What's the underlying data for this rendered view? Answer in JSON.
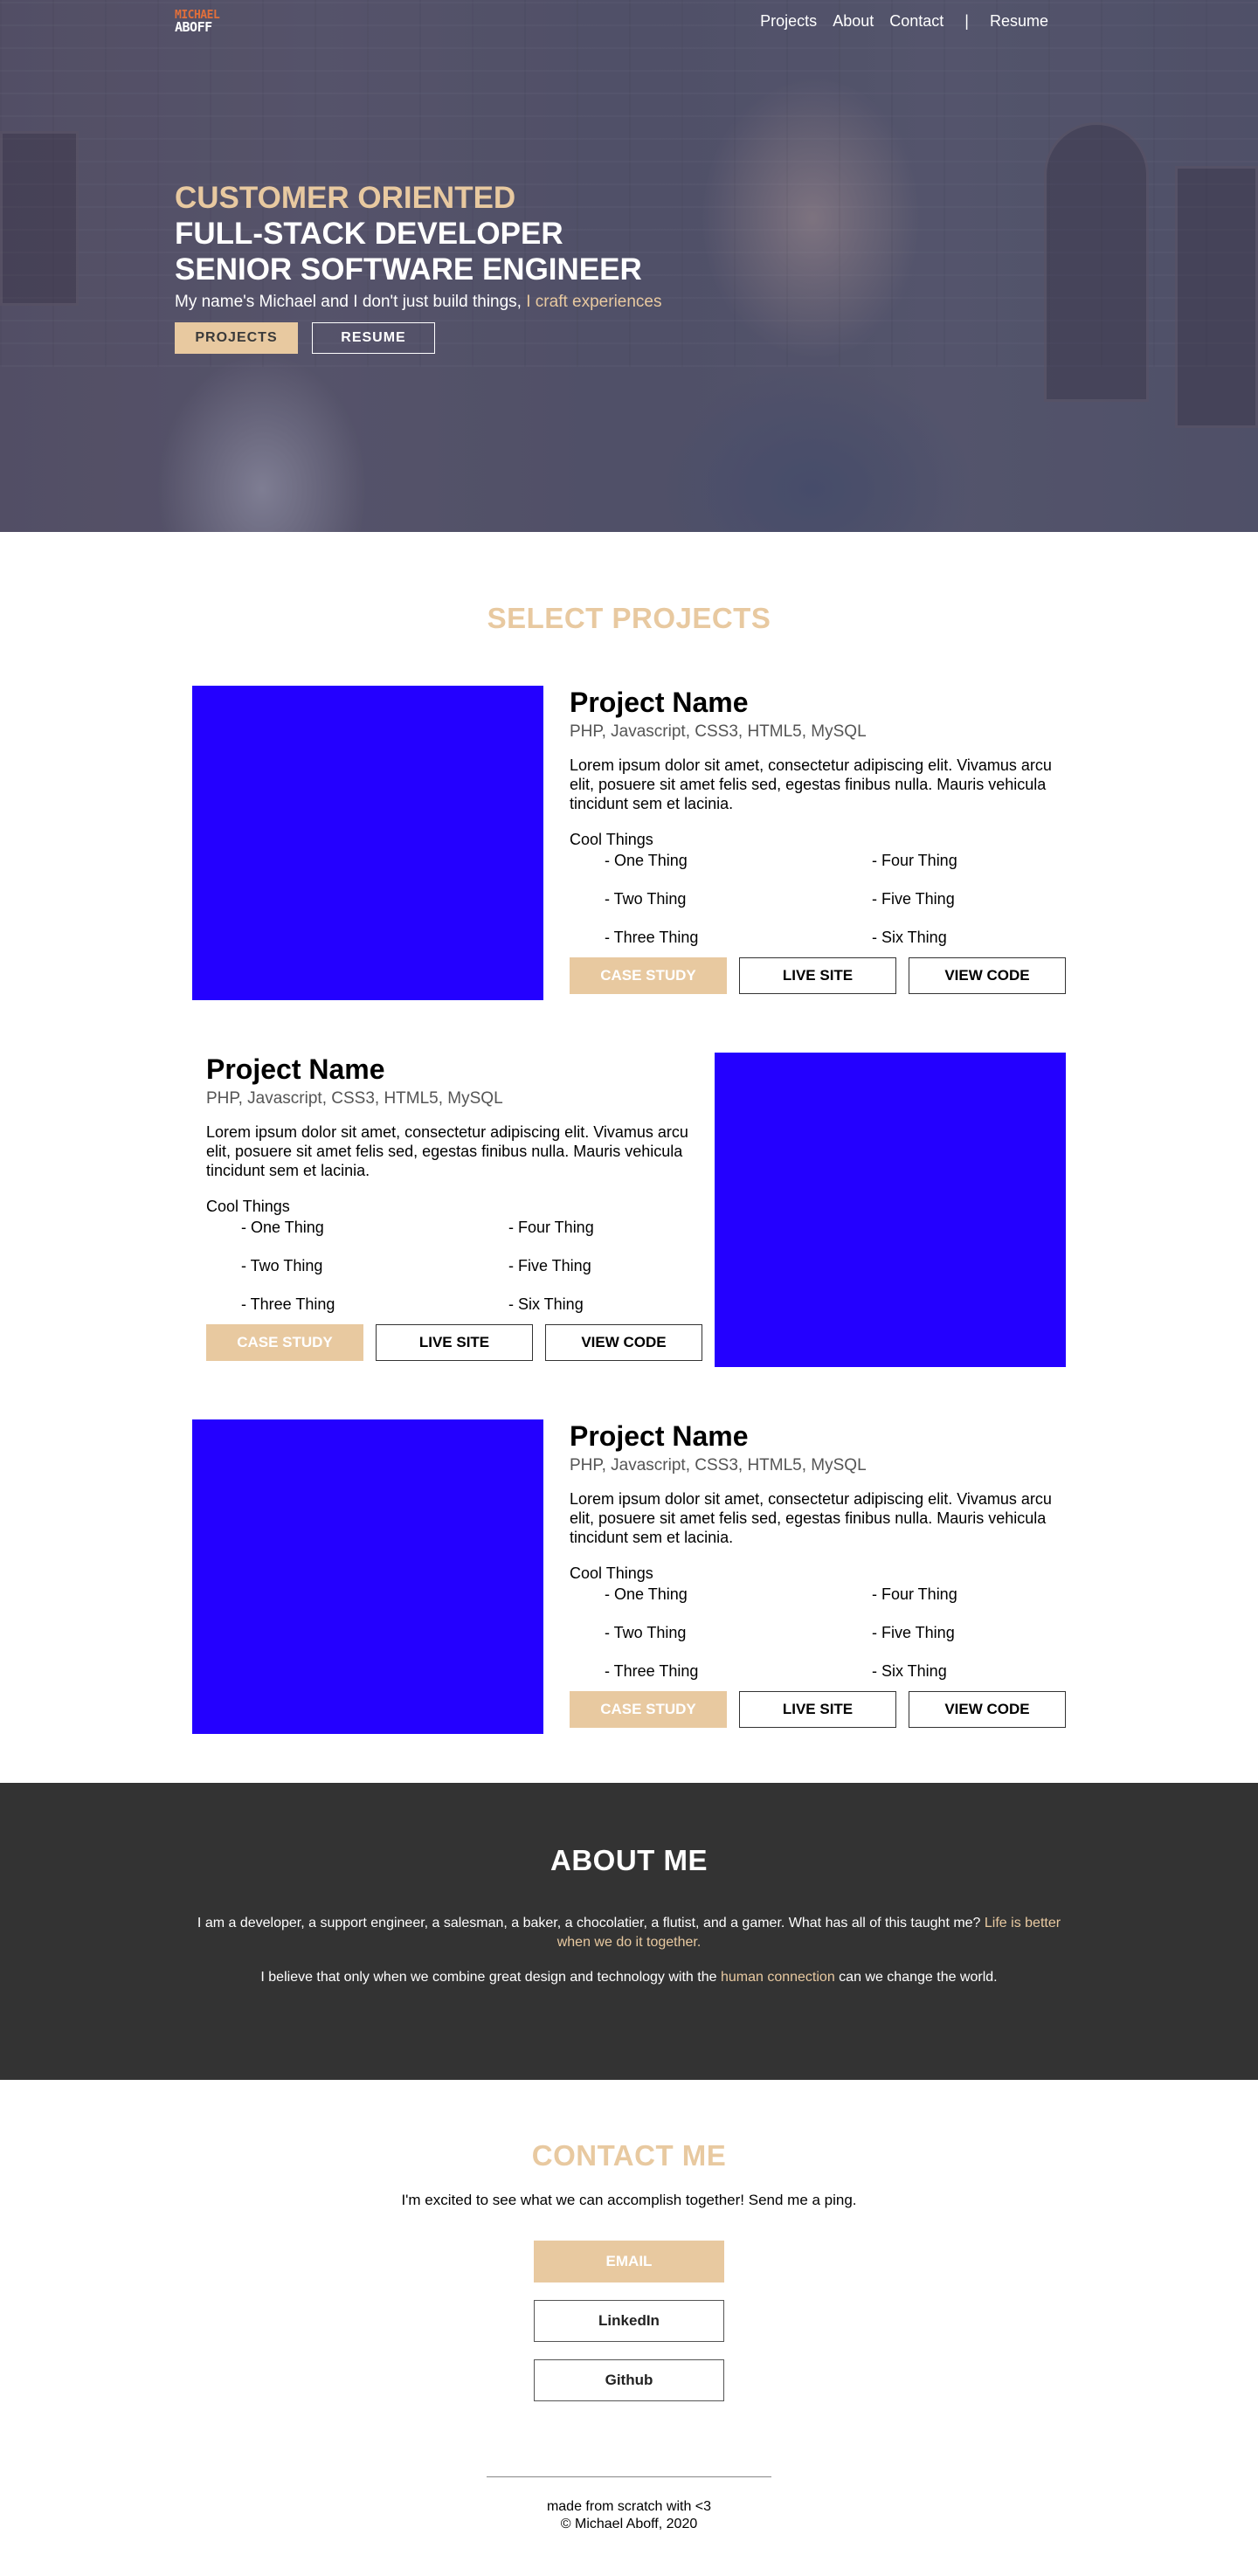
{
  "brand": {
    "logo_line1": "MICHAEL",
    "logo_line2": "ABOFF"
  },
  "nav": {
    "items": [
      {
        "label": "Projects"
      },
      {
        "label": "About"
      },
      {
        "label": "Contact"
      }
    ],
    "separator": "|",
    "resume_label": "Resume"
  },
  "hero": {
    "line1": "CUSTOMER ORIENTED",
    "line2": "FULL-STACK DEVELOPER",
    "line3": "SENIOR SOFTWARE ENGINEER",
    "sub_plain": "My name's Michael and I don't just build things, ",
    "sub_accent": "I craft experiences",
    "projects_button": "PROJECTS",
    "resume_button": "RESUME"
  },
  "projects": {
    "title": "SELECT PROJECTS",
    "list": [
      {
        "name": "Project Name",
        "tech": "PHP, Javascript, CSS3, HTML5, MySQL",
        "description": "Lorem ipsum dolor sit amet, consectetur adipiscing elit. Vivamus arcu elit, posuere sit amet felis sed, egestas finibus nulla. Mauris vehicula tincidunt sem et lacinia.",
        "cool_label": "Cool Things",
        "cool_things": [
          "- One Thing",
          "- Four Thing",
          "- Two Thing",
          "- Five Thing",
          "- Three Thing",
          "- Six Thing"
        ],
        "case_study": "CASE STUDY",
        "live_site": "LIVE SITE",
        "view_code": "VIEW CODE"
      },
      {
        "name": "Project Name",
        "tech": "PHP, Javascript, CSS3, HTML5, MySQL",
        "description": "Lorem ipsum dolor sit amet, consectetur adipiscing elit. Vivamus arcu elit, posuere sit amet felis sed, egestas finibus nulla. Mauris vehicula tincidunt sem et lacinia.",
        "cool_label": "Cool Things",
        "cool_things": [
          "- One Thing",
          "- Four Thing",
          "- Two Thing",
          "- Five Thing",
          "- Three Thing",
          "- Six Thing"
        ],
        "case_study": "CASE STUDY",
        "live_site": "LIVE SITE",
        "view_code": "VIEW CODE"
      },
      {
        "name": "Project Name",
        "tech": "PHP, Javascript, CSS3, HTML5, MySQL",
        "description": "Lorem ipsum dolor sit amet, consectetur adipiscing elit. Vivamus arcu elit, posuere sit amet felis sed, egestas finibus nulla. Mauris vehicula tincidunt sem et lacinia.",
        "cool_label": "Cool Things",
        "cool_things": [
          "- One Thing",
          "- Four Thing",
          "- Two Thing",
          "- Five Thing",
          "- Three Thing",
          "- Six Thing"
        ],
        "case_study": "CASE STUDY",
        "live_site": "LIVE SITE",
        "view_code": "VIEW CODE"
      }
    ]
  },
  "about": {
    "title": "ABOUT ME",
    "p1_plain": "I am a developer, a support engineer, a salesman, a baker, a chocolatier, a flutist, and a gamer. What has all of this taught me? ",
    "p1_accent": "Life is better when we do it together.",
    "p2_before": "I believe that only when we combine great design and technology with the ",
    "p2_accent": "human connection",
    "p2_after": " can we change the world."
  },
  "contact": {
    "title": "CONTACT ME",
    "subtitle": "I'm excited to see what we can accomplish together! Send me a ping.",
    "email_button": "EMAIL",
    "linkedin_button": "LinkedIn",
    "github_button": "Github"
  },
  "footer": {
    "line1": "made from scratch with <3",
    "line2": "© Michael Aboff, 2020"
  },
  "colors": {
    "accent": "#e8c9a0",
    "project_placeholder": "#2400ff",
    "about_bg": "#333333"
  }
}
